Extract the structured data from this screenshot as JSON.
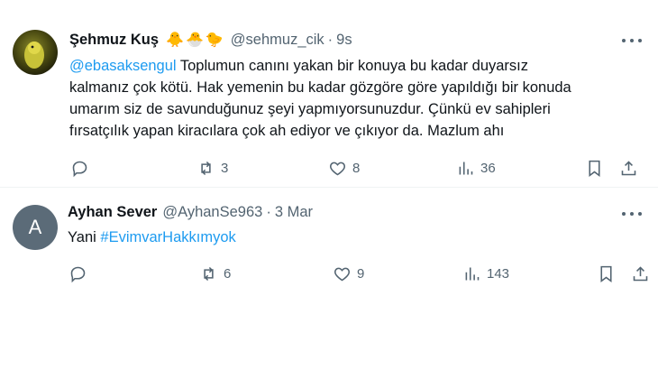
{
  "tweets": [
    {
      "author_name": "Şehmuz Kuş",
      "emojis": "🐥🐣🐤",
      "handle": "@sehmuz_cik",
      "separator": "·",
      "time": "9s",
      "avatar_style": "bird-photo",
      "body_lines": [
        {
          "mention": "@ebasaksengul",
          "text": " Toplumun canını yakan bir konuya bu kadar duyarsız"
        },
        {
          "text": "kalmanız çok kötü. Hak yemenin bu kadar gözgöre göre yapıldığı bir konuda"
        },
        {
          "text": "umarım siz de savunduğunuz şeyi yapmıyorsunuzdur. Çünkü ev sahipleri"
        },
        {
          "text": "fırsatçılık yapan  kiracılara çok ah ediyor ve çıkıyor da. Mazlum ahı"
        }
      ],
      "stats": {
        "retweets": "3",
        "likes": "8",
        "views": "36"
      }
    },
    {
      "author_name": "Ayhan Sever",
      "handle": "@AyhanSe963",
      "separator": "·",
      "time": "3 Mar",
      "avatar_letter": "A",
      "body": {
        "text": "Yani ",
        "hashtag": "#EvimvarHakkımyok"
      },
      "stats": {
        "retweets": "6",
        "likes": "9",
        "views": "143"
      }
    }
  ],
  "icons": [
    "reply-icon",
    "retweet-icon",
    "like-icon",
    "views-icon",
    "bookmark-icon",
    "share-icon",
    "more-icon"
  ],
  "colors": {
    "link": "#1d9bf0",
    "secondary": "#536471",
    "text": "#0f1419"
  }
}
